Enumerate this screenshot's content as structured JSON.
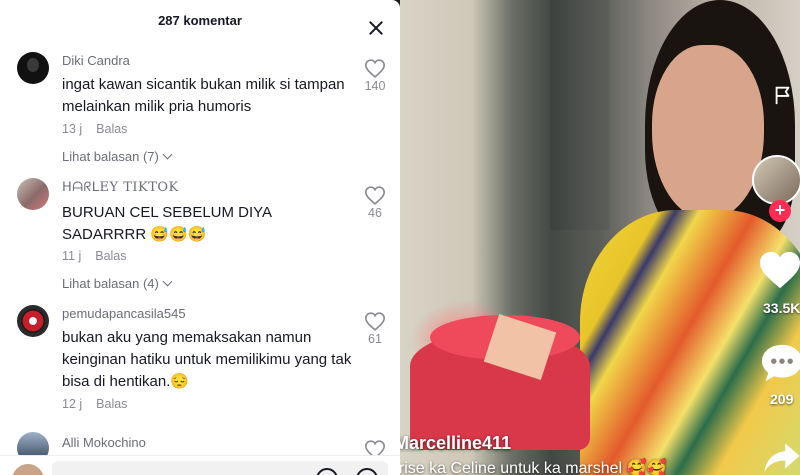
{
  "comments_panel": {
    "count_label": "287 komentar",
    "comments": [
      {
        "username": "Diki Candra",
        "text": "ingat kawan sicantik bukan milik si tampan melainkan milik pria humoris",
        "time": "13 j",
        "reply_label": "Balas",
        "view_replies": "Lihat balasan (7)",
        "likes": "140"
      },
      {
        "username": "ᕼᗩᖇᒪEY TIKTOK",
        "text": "BURUAN CEL SEBELUM DIYA SADARRRR 😅😅😅",
        "time": "11 j",
        "reply_label": "Balas",
        "view_replies": "Lihat balasan (4)",
        "likes": "46"
      },
      {
        "username": "pemudapancasila545",
        "text": "bukan aku yang memaksakan namun keinginan hatiku untuk memilikimu yang tak bisa di hentikan.😔",
        "time": "12 j",
        "reply_label": "Balas",
        "likes": "61"
      },
      {
        "username": "Alli Mokochino"
      }
    ]
  },
  "video": {
    "author": "Marcelline411",
    "caption": "prise ka Celine untuk ka marshel 🥰🥰",
    "like_count": "33.5K",
    "comment_count": "209"
  },
  "colors": {
    "accent": "#fe2c55",
    "text_primary": "#161823",
    "text_secondary": "#8a8b91"
  }
}
